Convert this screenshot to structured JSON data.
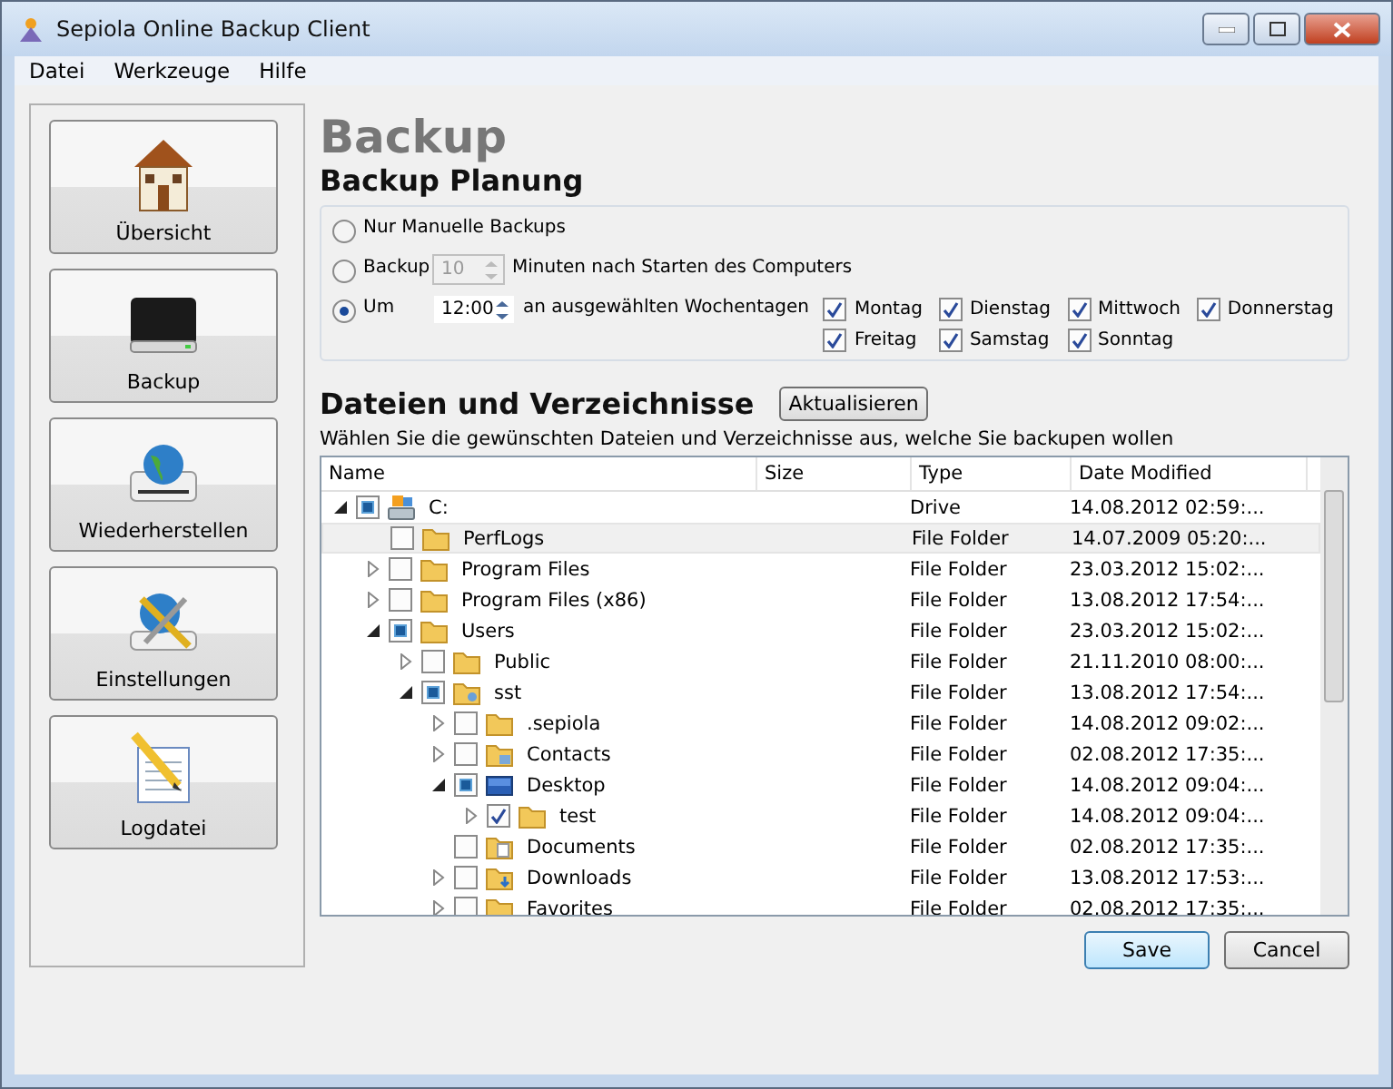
{
  "window": {
    "title": "Sepiola Online Backup Client"
  },
  "menu": [
    "Datei",
    "Werkzeuge",
    "Hilfe"
  ],
  "sidebar": {
    "items": [
      {
        "label": "Übersicht",
        "kind": "house"
      },
      {
        "label": "Backup",
        "kind": "drive"
      },
      {
        "label": "Wiederherstellen",
        "kind": "globe-drive"
      },
      {
        "label": "Einstellungen",
        "kind": "globe-tools"
      },
      {
        "label": "Logdatei",
        "kind": "notepad"
      }
    ]
  },
  "page_title": "Backup",
  "schedule": {
    "heading": "Backup Planung",
    "options": [
      {
        "kind": "plain",
        "label": "Nur Manuelle Backups",
        "selected": false
      },
      {
        "kind": "minutes",
        "label": "Backup",
        "spin": {
          "value": "10",
          "disabled": true
        },
        "suffix": "Minuten nach Starten des Computers",
        "selected": false
      },
      {
        "kind": "weekdays",
        "label": "Um",
        "spin": {
          "value": "12:00",
          "disabled": false
        },
        "suffix": "an ausgewählten Wochentagen",
        "selected": true,
        "days": [
          {
            "label": "Montag",
            "checked": true
          },
          {
            "label": "Dienstag",
            "checked": true
          },
          {
            "label": "Mittwoch",
            "checked": true
          },
          {
            "label": "Donnerstag",
            "checked": true
          },
          {
            "label": "Freitag",
            "checked": true
          },
          {
            "label": "Samstag",
            "checked": true
          },
          {
            "label": "Sonntag",
            "checked": true
          }
        ]
      }
    ]
  },
  "files": {
    "heading": "Dateien und Verzeichnisse",
    "refresh_button": "Aktualisieren",
    "description": "Wählen Sie die gewünschten Dateien und Verzeichnisse aus, welche Sie backupen wollen",
    "columns": [
      "Name",
      "Size",
      "Type",
      "Date Modified"
    ],
    "rows": [
      {
        "name": "C:",
        "kind": "drive",
        "type": "Drive",
        "date": "14.08.2012 02:59:...",
        "checked": true,
        "partial": true,
        "expanded": true,
        "selected": false,
        "children": [
          {
            "name": "PerfLogs",
            "kind": "folder",
            "type": "File Folder",
            "date": "14.07.2009 05:20:...",
            "checked": false,
            "selected": true
          },
          {
            "name": "Program Files",
            "kind": "folder",
            "type": "File Folder",
            "date": "23.03.2012 15:02:...",
            "checked": false,
            "expanded": false,
            "selected": false
          },
          {
            "name": "Program Files (x86)",
            "kind": "folder",
            "type": "File Folder",
            "date": "13.08.2012 17:54:...",
            "checked": false,
            "expanded": false,
            "selected": false
          },
          {
            "name": "Users",
            "kind": "folder",
            "type": "File Folder",
            "date": "23.03.2012 15:02:...",
            "checked": true,
            "partial": true,
            "expanded": true,
            "selected": false,
            "children": [
              {
                "name": "Public",
                "kind": "folder",
                "type": "File Folder",
                "date": "21.11.2010 08:00:...",
                "checked": false,
                "expanded": false,
                "selected": false
              },
              {
                "name": "sst",
                "kind": "user-folder",
                "type": "File Folder",
                "date": "13.08.2012 17:54:...",
                "checked": true,
                "partial": true,
                "expanded": true,
                "selected": false,
                "children": [
                  {
                    "name": ".sepiola",
                    "kind": "folder",
                    "type": "File Folder",
                    "date": "14.08.2012 09:02:...",
                    "checked": false,
                    "expanded": false,
                    "selected": false
                  },
                  {
                    "name": "Contacts",
                    "kind": "contacts",
                    "type": "File Folder",
                    "date": "02.08.2012 17:35:...",
                    "checked": false,
                    "expanded": false,
                    "selected": false
                  },
                  {
                    "name": "Desktop",
                    "kind": "desktop",
                    "type": "File Folder",
                    "date": "14.08.2012 09:04:...",
                    "checked": true,
                    "partial": true,
                    "expanded": true,
                    "selected": false,
                    "children": [
                      {
                        "name": "test",
                        "kind": "folder",
                        "type": "File Folder",
                        "date": "14.08.2012 09:04:...",
                        "checked": true,
                        "expanded": false,
                        "selected": false
                      }
                    ]
                  },
                  {
                    "name": "Documents",
                    "kind": "documents",
                    "type": "File Folder",
                    "date": "02.08.2012 17:35:...",
                    "checked": false,
                    "selected": false
                  },
                  {
                    "name": "Downloads",
                    "kind": "downloads",
                    "type": "File Folder",
                    "date": "13.08.2012 17:53:...",
                    "checked": false,
                    "expanded": false,
                    "selected": false
                  },
                  {
                    "name": "Favorites",
                    "kind": "folder",
                    "type": "File Folder",
                    "date": "02.08.2012 17:35:...",
                    "checked": false,
                    "expanded": false,
                    "selected": false
                  }
                ]
              }
            ]
          }
        ]
      }
    ]
  },
  "buttons": [
    {
      "label": "Save",
      "default": true
    },
    {
      "label": "Cancel",
      "default": false
    }
  ]
}
